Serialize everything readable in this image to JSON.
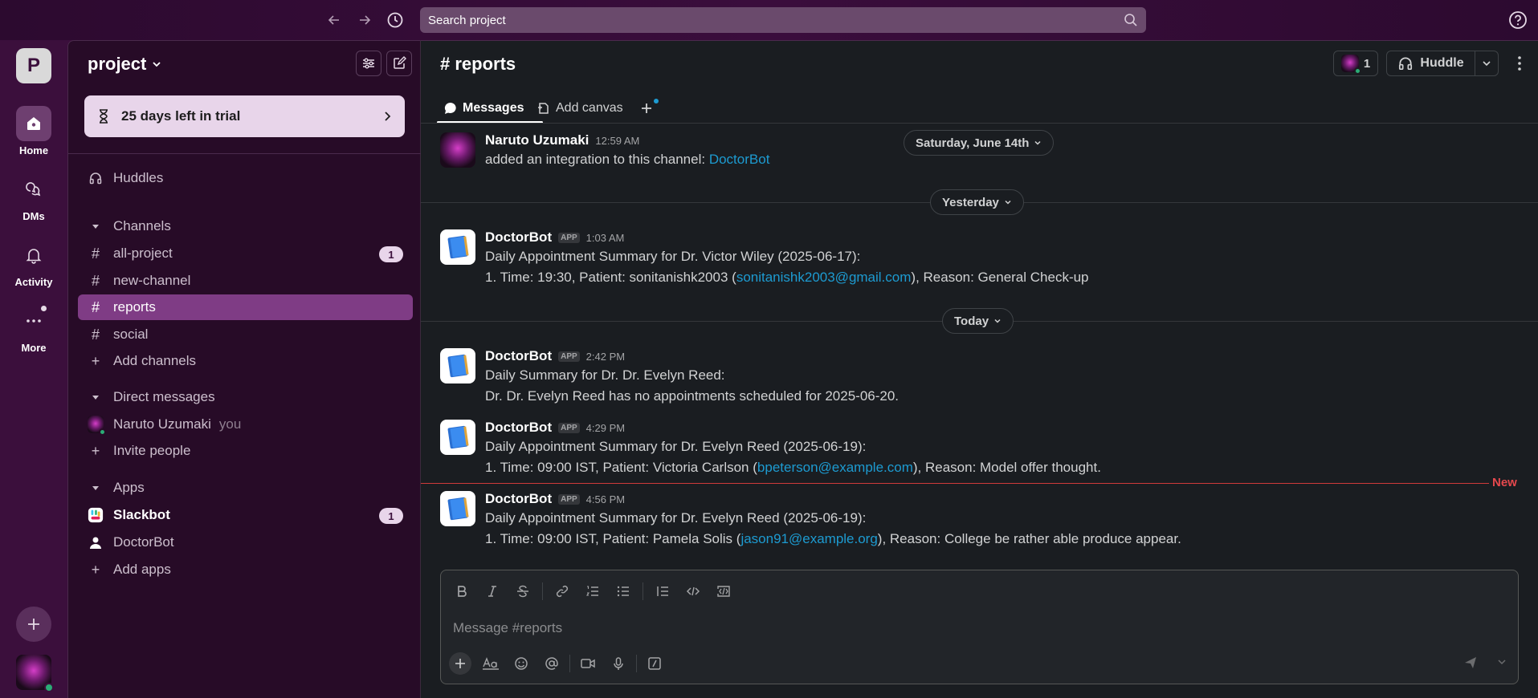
{
  "search": {
    "placeholder": "Search project"
  },
  "rail": {
    "workspace_initial": "P",
    "items": [
      {
        "label": "Home",
        "icon": "home-icon"
      },
      {
        "label": "DMs",
        "icon": "dms-icon"
      },
      {
        "label": "Activity",
        "icon": "bell-icon"
      },
      {
        "label": "More",
        "icon": "more-icon"
      }
    ]
  },
  "sidebar": {
    "workspace_name": "project",
    "trial_text": "25 days left in trial",
    "huddles": "Huddles",
    "channels_header": "Channels",
    "channels": [
      {
        "name": "all-project",
        "badge": "1"
      },
      {
        "name": "new-channel"
      },
      {
        "name": "reports"
      },
      {
        "name": "social"
      }
    ],
    "add_channels": "Add channels",
    "dm_header": "Direct messages",
    "dm_user": "Naruto Uzumaki",
    "dm_you": "you",
    "invite": "Invite people",
    "apps_header": "Apps",
    "apps": [
      {
        "name": "Slackbot",
        "badge": "1"
      },
      {
        "name": "DoctorBot"
      }
    ],
    "add_apps": "Add apps"
  },
  "channel": {
    "title": "# reports",
    "member_count": "1",
    "huddle_label": "Huddle",
    "tabs": {
      "messages": "Messages",
      "canvas": "Add canvas"
    }
  },
  "dates": {
    "d1": "Saturday, June 14th",
    "d2": "Yesterday",
    "d3": "Today"
  },
  "messages": [
    {
      "name": "Naruto Uzumaki",
      "time": "12:59 AM",
      "text": "added an integration to this channel: ",
      "link": "DoctorBot"
    },
    {
      "name": "DoctorBot",
      "app": "APP",
      "time": "1:03 AM",
      "line1": "Daily Appointment Summary for Dr. Victor Wiley (2025-06-17):",
      "line2_pre": "1. Time: 19:30, Patient: sonitanishk2003 (",
      "line2_link": "sonitanishk2003@gmail.com",
      "line2_post": "), Reason: General Check-up"
    },
    {
      "name": "DoctorBot",
      "app": "APP",
      "time": "2:42 PM",
      "line1": "Daily Summary for Dr. Dr. Evelyn Reed:",
      "line2": "Dr. Dr. Evelyn Reed has no appointments scheduled for 2025-06-20."
    },
    {
      "name": "DoctorBot",
      "app": "APP",
      "time": "4:29 PM",
      "line1": "Daily Appointment Summary for Dr. Evelyn Reed (2025-06-19):",
      "line2_pre": "1. Time: 09:00 IST, Patient: Victoria Carlson (",
      "line2_link": "bpeterson@example.com",
      "line2_post": "), Reason: Model offer thought."
    },
    {
      "name": "DoctorBot",
      "app": "APP",
      "time": "4:56 PM",
      "line1": "Daily Appointment Summary for Dr. Evelyn Reed (2025-06-19):",
      "line2_pre": "1. Time: 09:00 IST, Patient: Pamela Solis (",
      "line2_link": "jason91@example.org",
      "line2_post": "), Reason: College be rather able produce appear."
    }
  ],
  "new_marker": "New",
  "composer": {
    "placeholder": "Message #reports"
  },
  "colors": {
    "accent": "#7f3c85",
    "link": "#1d9bd1",
    "new": "#e5484d"
  }
}
